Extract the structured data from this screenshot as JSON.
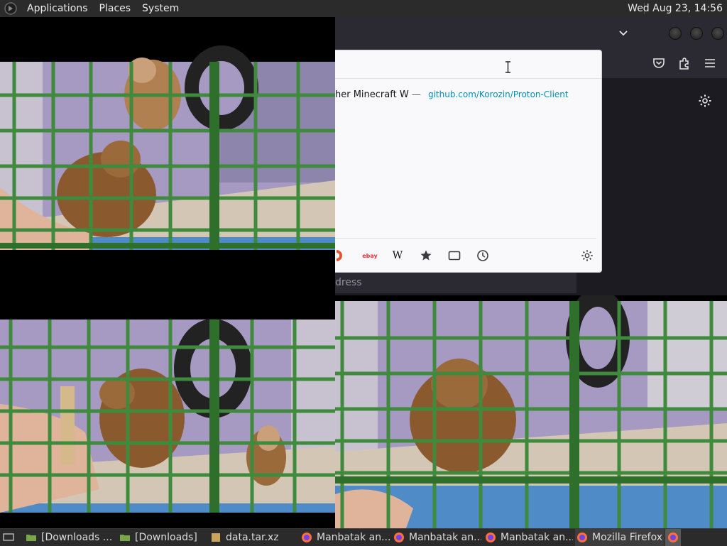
{
  "top_panel": {
    "menus": [
      "Applications",
      "Places",
      "System"
    ],
    "clock": "Wed Aug 23, 14:56"
  },
  "firefox": {
    "url_popup": {
      "result_title": "her Minecraft W",
      "result_dash": "—",
      "result_url": "github.com/Korozin/Proton-Client",
      "engines": [
        "duckduckgo",
        "ebay",
        "wikipedia",
        "bookmarks",
        "tabs",
        "history"
      ],
      "ebay_label": "ebay",
      "wiki_label": "W"
    },
    "search_placeholder": "dress"
  },
  "taskbar": {
    "items": [
      {
        "label": "[Downloads ..."
      },
      {
        "label": "[Downloads]"
      },
      {
        "label": "data.tar.xz"
      },
      {
        "label": "Manbatak an..."
      },
      {
        "label": "Manbatak an..."
      },
      {
        "label": "Manbatak an..."
      },
      {
        "label": "Mozilla Firefox"
      }
    ]
  },
  "colors": {
    "panel": "#2b2b2b",
    "firefox_bg": "#1c1b22",
    "popup_bg": "#f9f9fb",
    "link": "#0090b8",
    "cage": "#3f8a3c",
    "wall": "#a69ac2"
  }
}
